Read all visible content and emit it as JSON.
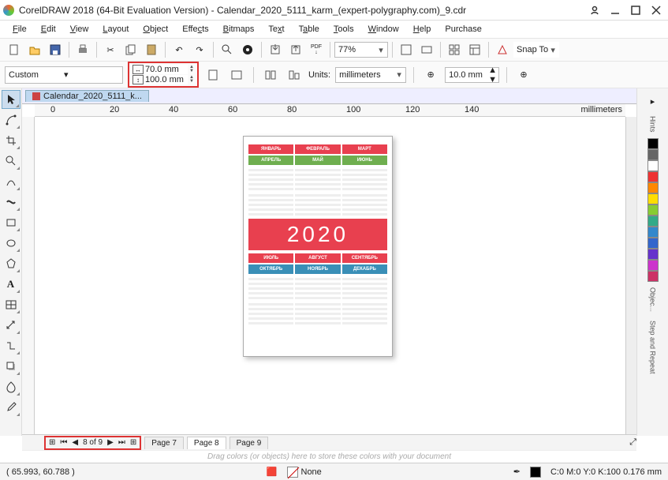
{
  "title": "CorelDRAW 2018 (64-Bit Evaluation Version) - Calendar_2020_5111_karm_(expert-polygraphy.com)_9.cdr",
  "menu": [
    "File",
    "Edit",
    "View",
    "Layout",
    "Object",
    "Effects",
    "Bitmaps",
    "Text",
    "Table",
    "Tools",
    "Window",
    "Help",
    "Purchase"
  ],
  "toolbar": {
    "zoom": "77%",
    "snap": "Snap To"
  },
  "propbar": {
    "preset": "Custom",
    "width": "70.0 mm",
    "height": "100.0 mm",
    "units_label": "Units:",
    "units_value": "millimeters",
    "nudge": "10.0 mm"
  },
  "doc_tab": "Calendar_2020_5111_k...",
  "ruler": {
    "marks": [
      "0",
      "20",
      "40",
      "60",
      "80",
      "100",
      "120",
      "140"
    ],
    "unit": "millimeters"
  },
  "calendar": {
    "year": "2020",
    "top": [
      {
        "n": "ЯНВАРЬ",
        "c": "#e8404f"
      },
      {
        "n": "ФЕВРАЛЬ",
        "c": "#e8404f"
      },
      {
        "n": "МАРТ",
        "c": "#e8404f"
      },
      {
        "n": "АПРЕЛЬ",
        "c": "#6fae4f"
      },
      {
        "n": "МАЙ",
        "c": "#6fae4f"
      },
      {
        "n": "ИЮНЬ",
        "c": "#6fae4f"
      }
    ],
    "bot": [
      {
        "n": "ИЮЛЬ",
        "c": "#e8404f"
      },
      {
        "n": "АВГУСТ",
        "c": "#e8404f"
      },
      {
        "n": "СЕНТЯБРЬ",
        "c": "#e8404f"
      },
      {
        "n": "ОКТЯБРЬ",
        "c": "#3a8fb7"
      },
      {
        "n": "НОЯБРЬ",
        "c": "#3a8fb7"
      },
      {
        "n": "ДЕКАБРЬ",
        "c": "#3a8fb7"
      }
    ]
  },
  "right_panels": [
    "Hints",
    "Objec...",
    "Step and Repeat"
  ],
  "swatches": [
    "#000",
    "#666",
    "#fff",
    "#e33",
    "#f80",
    "#fd0",
    "#8c3",
    "#3a8",
    "#38c",
    "#36c",
    "#63c",
    "#c3c",
    "#c36"
  ],
  "pager": {
    "pos": "8 of 9",
    "pages": [
      "Page 7",
      "Page 8",
      "Page 9"
    ],
    "active": 1
  },
  "color_hint": "Drag colors (or objects) here to store these colors with your document",
  "status": {
    "coords": "( 65.993, 60.788 )",
    "fill_label": "None",
    "outline": "C:0 M:0 Y:0 K:100  0.176 mm"
  }
}
